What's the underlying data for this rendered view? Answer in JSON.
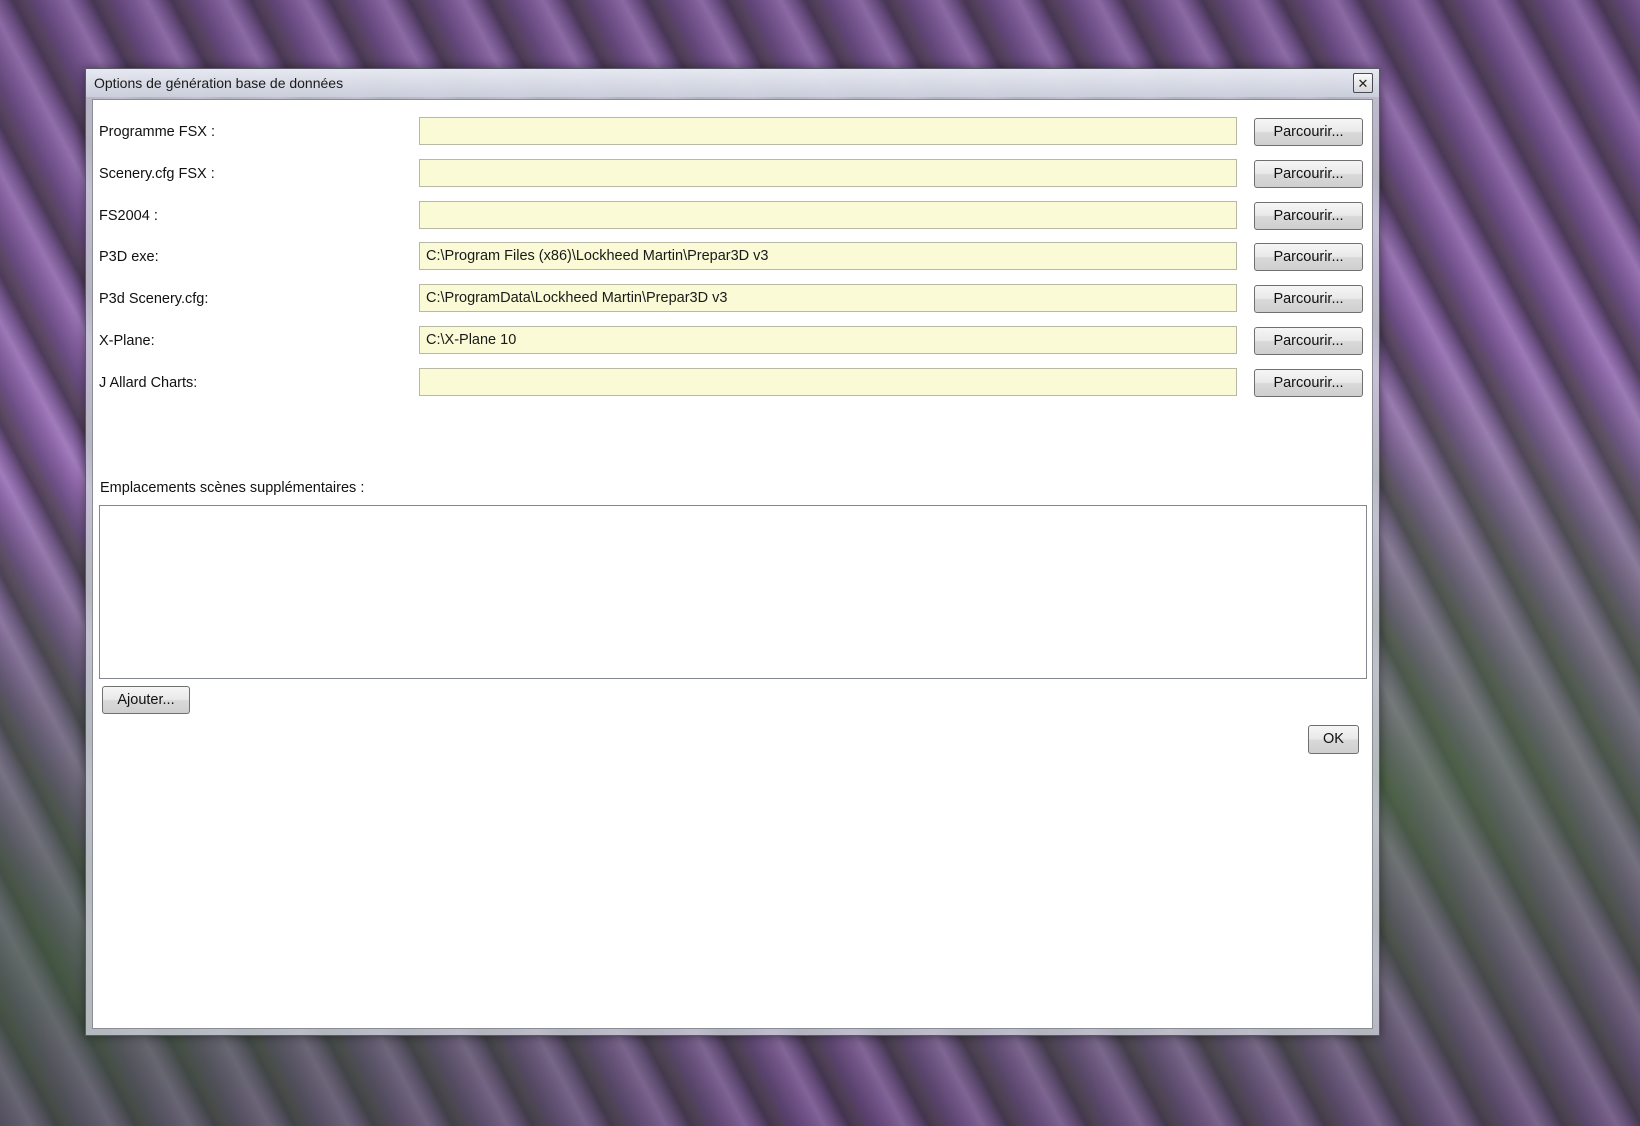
{
  "window": {
    "title": "Options de génération base de données",
    "close_glyph": "✕"
  },
  "paths": [
    {
      "id": "programme-fsx",
      "label": "Programme FSX :",
      "value": "",
      "browse_label": "Parcourir..."
    },
    {
      "id": "scenery-cfg-fsx",
      "label": "Scenery.cfg FSX :",
      "value": "",
      "browse_label": "Parcourir..."
    },
    {
      "id": "fs2004",
      "label": "FS2004 :",
      "value": "",
      "browse_label": "Parcourir..."
    },
    {
      "id": "p3d-exe",
      "label": "P3D exe:",
      "value": "C:\\Program Files (x86)\\Lockheed Martin\\Prepar3D v3",
      "browse_label": "Parcourir..."
    },
    {
      "id": "p3d-scenery-cfg",
      "label": "P3d Scenery.cfg:",
      "value": "C:\\ProgramData\\Lockheed Martin\\Prepar3D v3",
      "browse_label": "Parcourir..."
    },
    {
      "id": "x-plane",
      "label": "X-Plane:",
      "value": "C:\\X-Plane 10",
      "browse_label": "Parcourir..."
    },
    {
      "id": "j-allard-charts",
      "label": "J Allard Charts:",
      "value": "",
      "browse_label": "Parcourir..."
    }
  ],
  "extra_scenery": {
    "label": "Emplacements scènes supplémentaires :",
    "items": [],
    "add_label": "Ajouter..."
  },
  "ok_label": "OK",
  "colors": {
    "field_background": "#fafad6"
  }
}
